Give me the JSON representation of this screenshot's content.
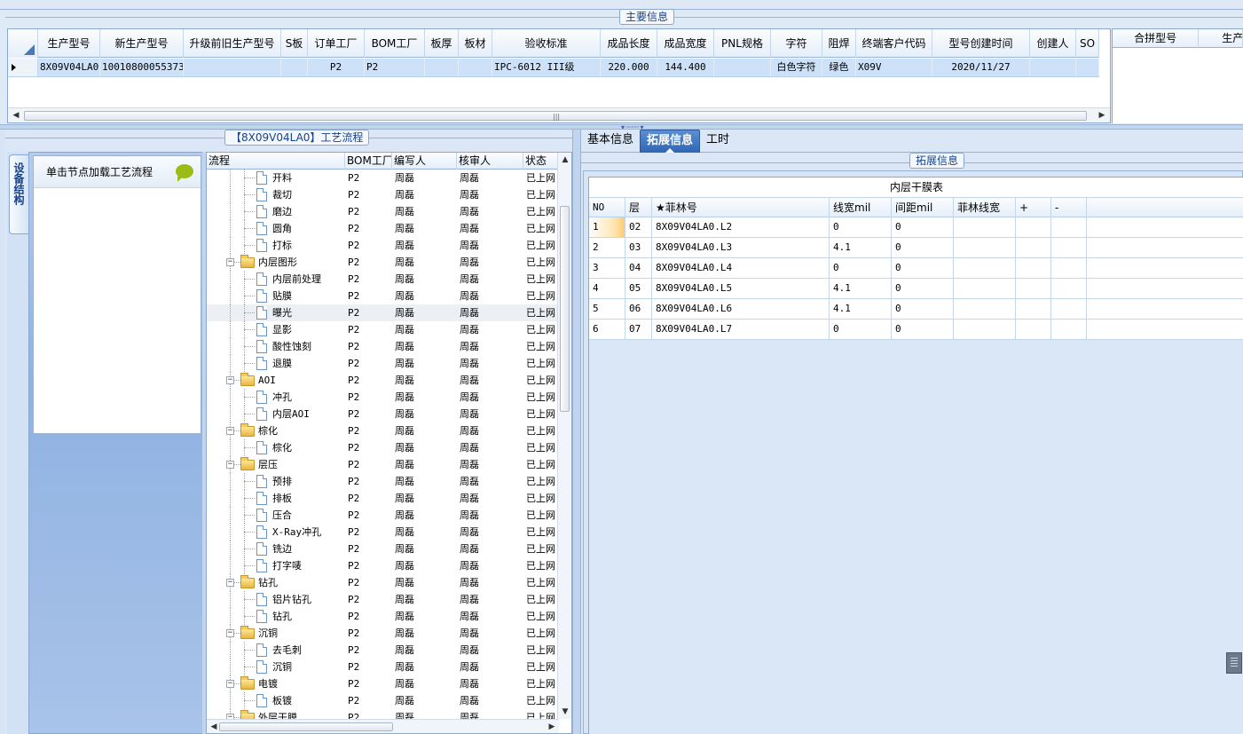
{
  "main_info": {
    "group_title": "主要信息",
    "columns": [
      "生产型号",
      "新生产型号",
      "升级前旧生产型号",
      "S板",
      "订单工厂",
      "BOM工厂",
      "板厚",
      "板材",
      "验收标准",
      "成品长度",
      "成品宽度",
      "PNL规格",
      "字符",
      "阻焊",
      "终端客户代码",
      "型号创建时间",
      "创建人",
      "SO"
    ],
    "row": [
      "8X09V04LA0",
      "10010800055373",
      "",
      "",
      "P2",
      "P2",
      "",
      "",
      "IPC-6012 III级",
      "220.000",
      "144.400",
      "",
      "白色字符",
      "绿色",
      "X09V",
      "2020/11/27",
      "",
      ""
    ]
  },
  "merge_grid": {
    "columns": [
      "合拼型号",
      "生产"
    ]
  },
  "left": {
    "group_title": "【8X09V04LA0】工艺流程",
    "nav_tab": "设备结构",
    "flow_hint": "单击节点加载工艺流程",
    "tree_columns": [
      "流程",
      "BOM工厂",
      "编写人",
      "核审人",
      "状态"
    ],
    "tree": [
      {
        "label": "开料",
        "type": "doc",
        "bom": "P2",
        "writer": "周磊",
        "checker": "周磊",
        "status": "已上网"
      },
      {
        "label": "裁切",
        "type": "doc",
        "bom": "P2",
        "writer": "周磊",
        "checker": "周磊",
        "status": "已上网"
      },
      {
        "label": "磨边",
        "type": "doc",
        "bom": "P2",
        "writer": "周磊",
        "checker": "周磊",
        "status": "已上网"
      },
      {
        "label": "圆角",
        "type": "doc",
        "bom": "P2",
        "writer": "周磊",
        "checker": "周磊",
        "status": "已上网"
      },
      {
        "label": "打标",
        "type": "doc",
        "bom": "P2",
        "writer": "周磊",
        "checker": "周磊",
        "status": "已上网"
      },
      {
        "label": "内层图形",
        "type": "folder",
        "bom": "P2",
        "writer": "周磊",
        "checker": "周磊",
        "status": "已上网"
      },
      {
        "label": "内层前处理",
        "type": "doc",
        "bom": "P2",
        "writer": "周磊",
        "checker": "周磊",
        "status": "已上网"
      },
      {
        "label": "贴膜",
        "type": "doc",
        "bom": "P2",
        "writer": "周磊",
        "checker": "周磊",
        "status": "已上网"
      },
      {
        "label": "曝光",
        "type": "doc",
        "bom": "P2",
        "writer": "周磊",
        "checker": "周磊",
        "status": "已上网",
        "selected": true
      },
      {
        "label": "显影",
        "type": "doc",
        "bom": "P2",
        "writer": "周磊",
        "checker": "周磊",
        "status": "已上网"
      },
      {
        "label": "酸性蚀刻",
        "type": "doc",
        "bom": "P2",
        "writer": "周磊",
        "checker": "周磊",
        "status": "已上网"
      },
      {
        "label": "退膜",
        "type": "doc",
        "bom": "P2",
        "writer": "周磊",
        "checker": "周磊",
        "status": "已上网"
      },
      {
        "label": "AOI",
        "type": "folder",
        "bom": "P2",
        "writer": "周磊",
        "checker": "周磊",
        "status": "已上网"
      },
      {
        "label": "冲孔",
        "type": "doc",
        "bom": "P2",
        "writer": "周磊",
        "checker": "周磊",
        "status": "已上网"
      },
      {
        "label": "内层AOI",
        "type": "doc",
        "bom": "P2",
        "writer": "周磊",
        "checker": "周磊",
        "status": "已上网"
      },
      {
        "label": "棕化",
        "type": "folder",
        "bom": "P2",
        "writer": "周磊",
        "checker": "周磊",
        "status": "已上网"
      },
      {
        "label": "棕化",
        "type": "doc",
        "bom": "P2",
        "writer": "周磊",
        "checker": "周磊",
        "status": "已上网"
      },
      {
        "label": "层压",
        "type": "folder",
        "bom": "P2",
        "writer": "周磊",
        "checker": "周磊",
        "status": "已上网"
      },
      {
        "label": "预排",
        "type": "doc",
        "bom": "P2",
        "writer": "周磊",
        "checker": "周磊",
        "status": "已上网"
      },
      {
        "label": "排板",
        "type": "doc",
        "bom": "P2",
        "writer": "周磊",
        "checker": "周磊",
        "status": "已上网"
      },
      {
        "label": "压合",
        "type": "doc",
        "bom": "P2",
        "writer": "周磊",
        "checker": "周磊",
        "status": "已上网"
      },
      {
        "label": "X-Ray冲孔",
        "type": "doc",
        "bom": "P2",
        "writer": "周磊",
        "checker": "周磊",
        "status": "已上网"
      },
      {
        "label": "铣边",
        "type": "doc",
        "bom": "P2",
        "writer": "周磊",
        "checker": "周磊",
        "status": "已上网"
      },
      {
        "label": "打字唛",
        "type": "doc",
        "bom": "P2",
        "writer": "周磊",
        "checker": "周磊",
        "status": "已上网"
      },
      {
        "label": "钻孔",
        "type": "folder",
        "bom": "P2",
        "writer": "周磊",
        "checker": "周磊",
        "status": "已上网"
      },
      {
        "label": "铝片钻孔",
        "type": "doc",
        "bom": "P2",
        "writer": "周磊",
        "checker": "周磊",
        "status": "已上网"
      },
      {
        "label": "钻孔",
        "type": "doc",
        "bom": "P2",
        "writer": "周磊",
        "checker": "周磊",
        "status": "已上网"
      },
      {
        "label": "沉铜",
        "type": "folder",
        "bom": "P2",
        "writer": "周磊",
        "checker": "周磊",
        "status": "已上网"
      },
      {
        "label": "去毛刺",
        "type": "doc",
        "bom": "P2",
        "writer": "周磊",
        "checker": "周磊",
        "status": "已上网"
      },
      {
        "label": "沉铜",
        "type": "doc",
        "bom": "P2",
        "writer": "周磊",
        "checker": "周磊",
        "status": "已上网"
      },
      {
        "label": "电镀",
        "type": "folder",
        "bom": "P2",
        "writer": "周磊",
        "checker": "周磊",
        "status": "已上网"
      },
      {
        "label": "板镀",
        "type": "doc",
        "bom": "P2",
        "writer": "周磊",
        "checker": "周磊",
        "status": "已上网"
      },
      {
        "label": "外层干膜",
        "type": "folder",
        "bom": "P2",
        "writer": "周磊",
        "checker": "周磊",
        "status": "已上网"
      }
    ]
  },
  "right": {
    "tabs": [
      "基本信息",
      "拓展信息",
      "工时"
    ],
    "active_tab": "拓展信息",
    "group_title": "拓展信息",
    "table_caption": "内层干膜表",
    "columns": [
      "NO",
      "层",
      "★菲林号",
      "线宽mil",
      "间距mil",
      "菲林线宽",
      "+",
      "-"
    ],
    "rows": [
      [
        "1",
        "02",
        "8X09V04LA0.L2",
        "0",
        "0",
        "",
        "",
        ""
      ],
      [
        "2",
        "03",
        "8X09V04LA0.L3",
        "4.1",
        "0",
        "",
        "",
        ""
      ],
      [
        "3",
        "04",
        "8X09V04LA0.L4",
        "0",
        "0",
        "",
        "",
        ""
      ],
      [
        "4",
        "05",
        "8X09V04LA0.L5",
        "4.1",
        "0",
        "",
        "",
        ""
      ],
      [
        "5",
        "06",
        "8X09V04LA0.L6",
        "4.1",
        "0",
        "",
        "",
        ""
      ],
      [
        "6",
        "07",
        "8X09V04LA0.L7",
        "0",
        "0",
        "",
        "",
        ""
      ]
    ]
  },
  "colors": {
    "accent": "#2f66b3",
    "selected_row": "#cde2f8",
    "panel": "#dbe7f6"
  }
}
